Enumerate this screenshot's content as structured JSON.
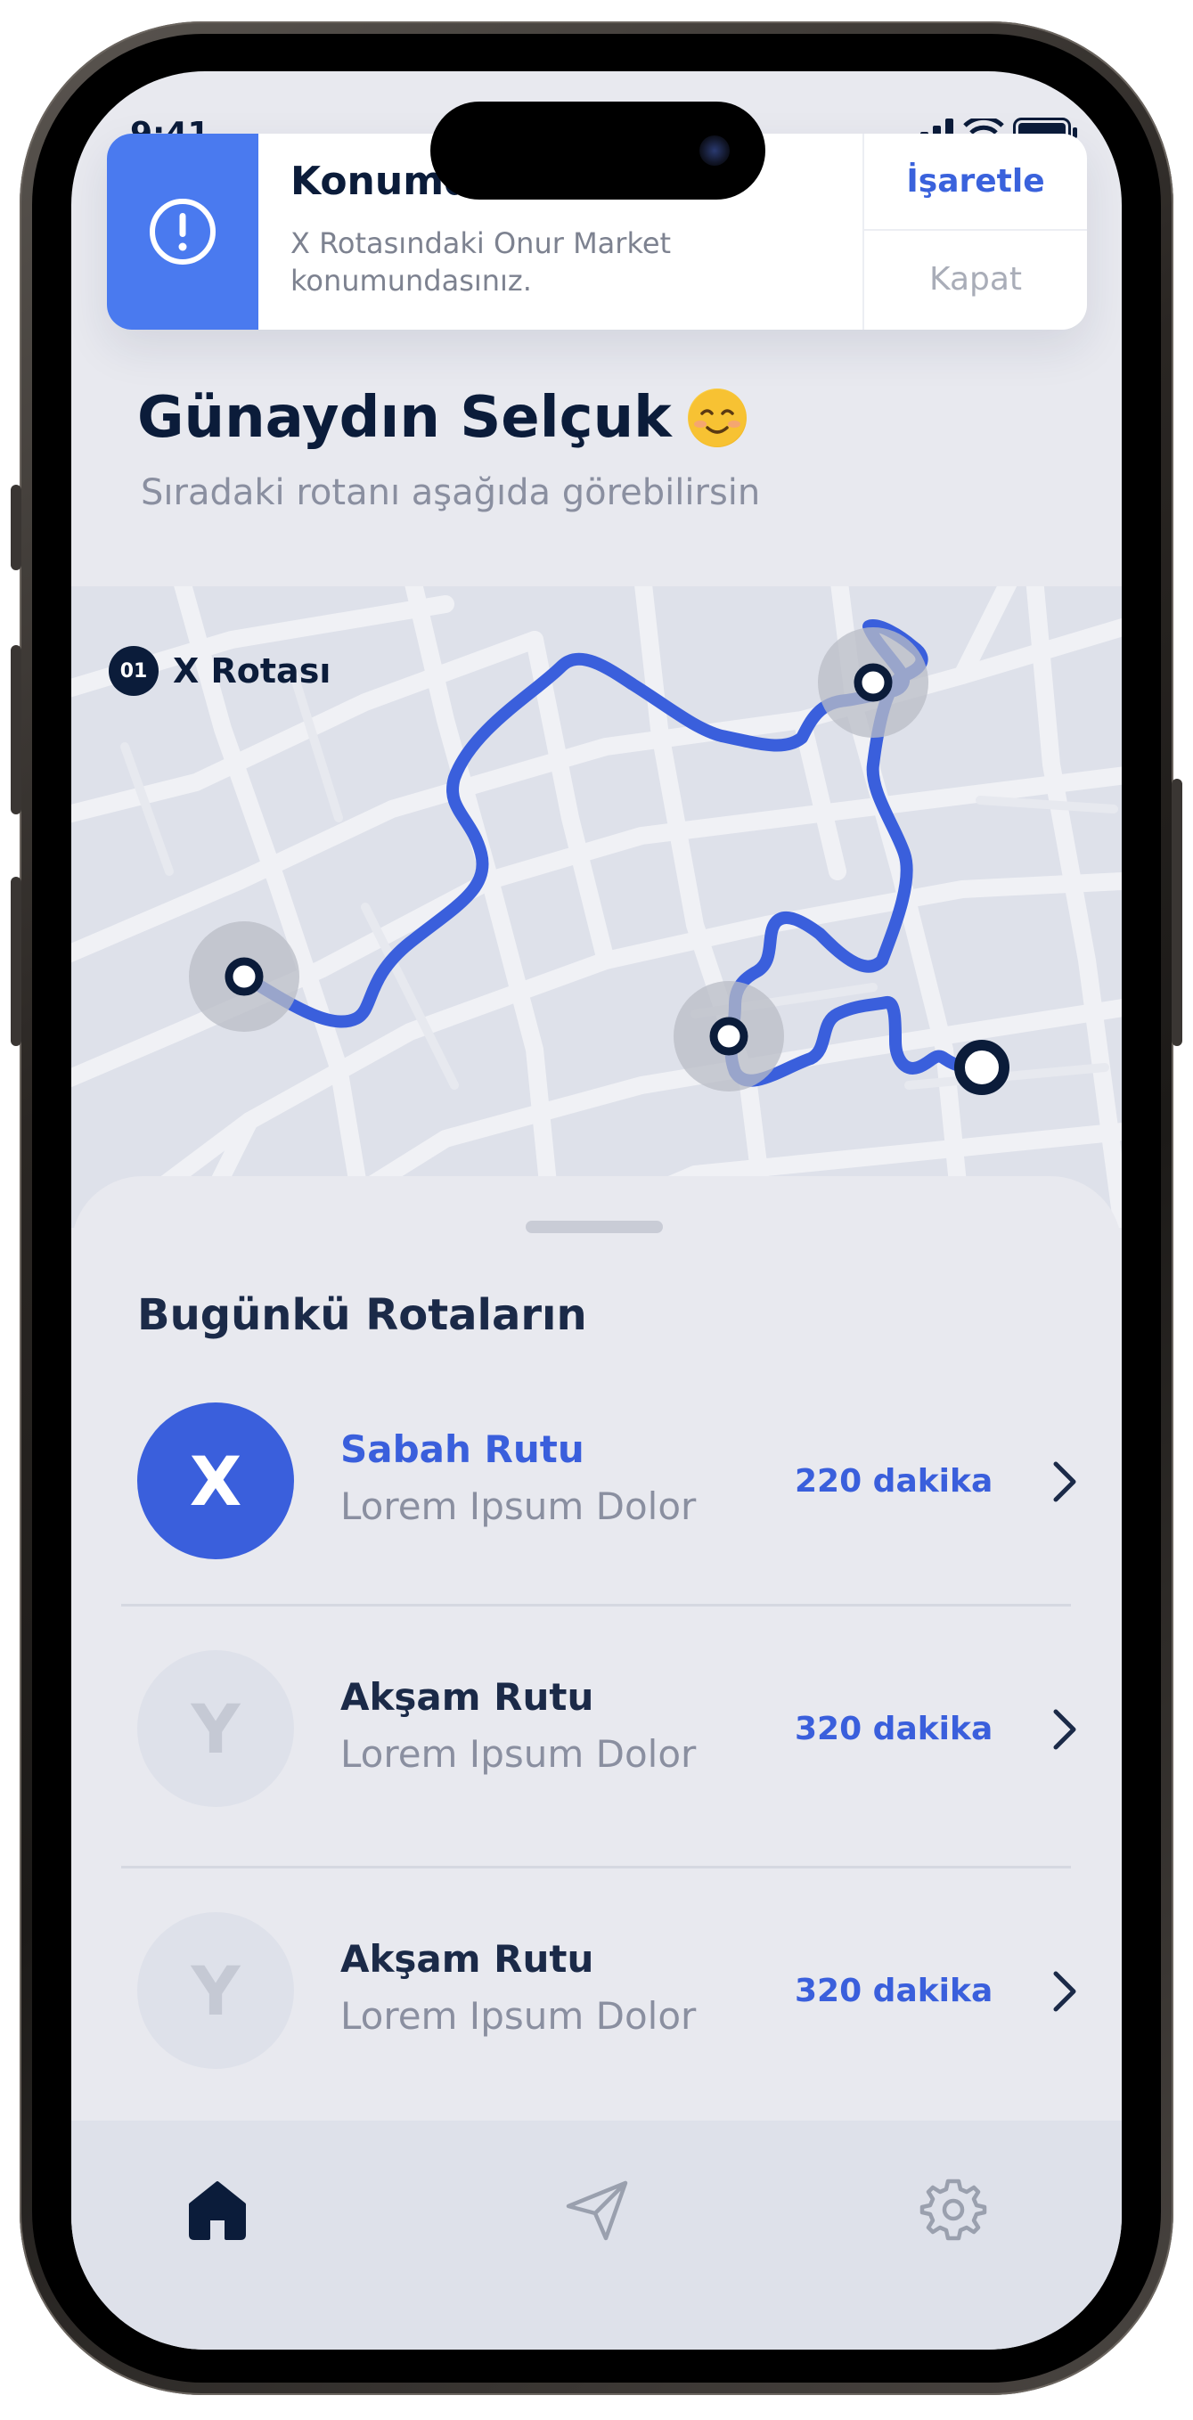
{
  "status": {
    "time": "9:41"
  },
  "notification": {
    "title": "Konumda Oldunuz!",
    "body": "X Rotasındaki Onur Market konumundasınız.",
    "primary_action": "İşaretle",
    "secondary_action": "Kapat",
    "icon": "alert-icon"
  },
  "greeting": {
    "title": "Günaydın Selçuk",
    "subtitle": "Sıradaki rotanı aşağıda görebilirsin",
    "emoji": "smiling-emoji"
  },
  "map": {
    "route_number": "01",
    "route_name": "X Rotası"
  },
  "routes": {
    "title": "Bugünkü Rotaların",
    "items": [
      {
        "letter": "X",
        "title": "Sabah Rutu",
        "subtitle": "Lorem Ipsum Dolor",
        "duration": "220 dakika",
        "active": true
      },
      {
        "letter": "Y",
        "title": "Akşam Rutu",
        "subtitle": "Lorem Ipsum Dolor",
        "duration": "320 dakika",
        "active": false
      },
      {
        "letter": "Y",
        "title": "Akşam Rutu",
        "subtitle": "Lorem Ipsum Dolor",
        "duration": "320 dakika",
        "active": false
      }
    ]
  },
  "tabbar": {
    "tabs": [
      {
        "icon": "home-icon",
        "active": true
      },
      {
        "icon": "send-icon",
        "active": false
      },
      {
        "icon": "gear-icon",
        "active": false
      }
    ]
  },
  "colors": {
    "accent": "#3a5fdc",
    "dark": "#0b1c3a",
    "notification_icon_bg": "#4a7aef"
  }
}
